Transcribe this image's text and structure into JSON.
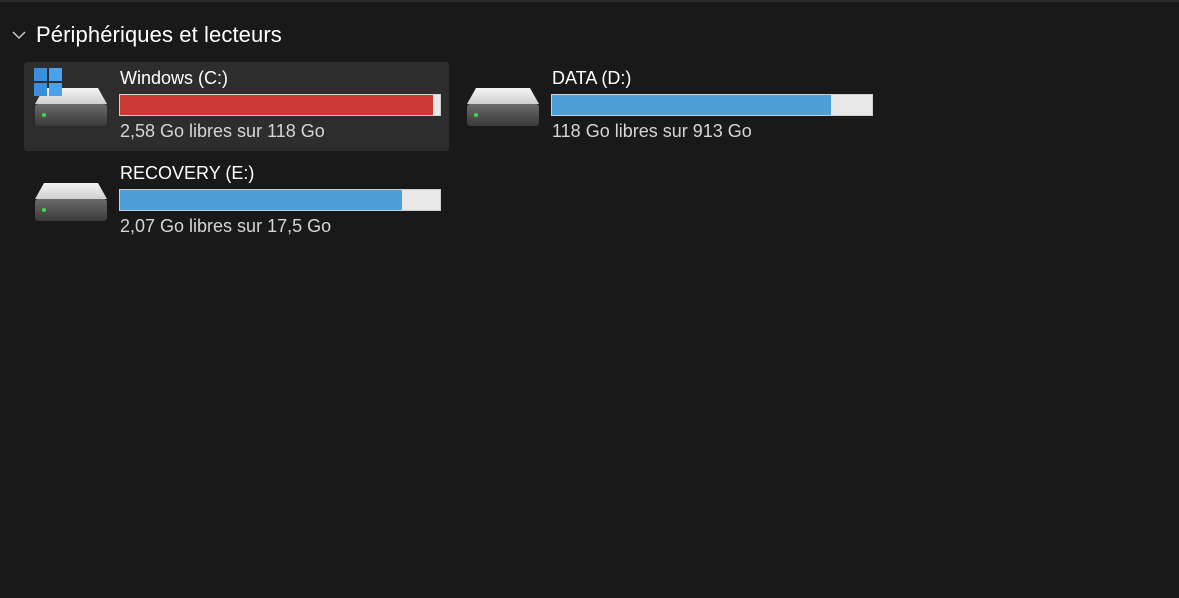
{
  "section": {
    "title": "Périphériques et lecteurs",
    "chevron_icon": "chevron-down-icon"
  },
  "colors": {
    "background": "#191919",
    "selected_background": "#2d2d2d",
    "bar_normal": "#4d9fd8",
    "bar_critical": "#cb3a34",
    "bar_track": "#e8e8e8"
  },
  "drives": [
    {
      "label": "Windows (C:)",
      "free_text": "2,58 Go libres sur 118 Go",
      "used_fraction": 0.978,
      "status": "critical",
      "selected": true,
      "icon": "hard-drive-icon",
      "os_icon": "windows-logo-icon"
    },
    {
      "label": "DATA (D:)",
      "free_text": "118 Go libres sur 913 Go",
      "used_fraction": 0.871,
      "status": "normal",
      "selected": false,
      "icon": "hard-drive-icon"
    },
    {
      "label": "RECOVERY (E:)",
      "free_text": "2,07 Go libres sur 17,5 Go",
      "used_fraction": 0.882,
      "status": "normal",
      "selected": false,
      "icon": "hard-drive-icon"
    }
  ]
}
